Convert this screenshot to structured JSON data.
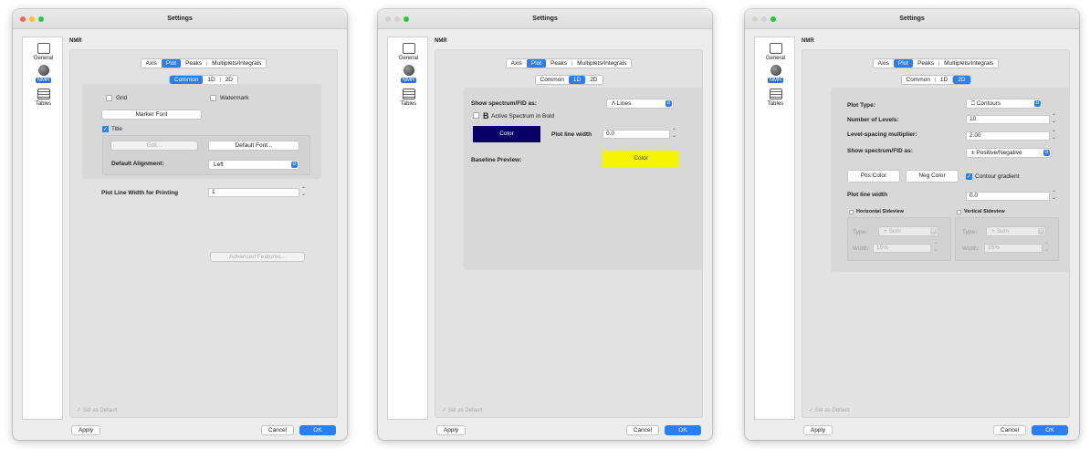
{
  "windows": [
    {
      "title": "Settings",
      "sidebar": [
        "General",
        "NMR",
        "Tables"
      ],
      "section_title": "NMR",
      "tabs": [
        "Axis",
        "Plot",
        "Peaks",
        "Multiplets/Integrals"
      ],
      "selected_tab": "Plot",
      "subtabs": [
        "Common",
        "1D",
        "2D"
      ],
      "selected_subtab": "Common",
      "common": {
        "grid_label": "Grid",
        "watermark_label": "Watermark",
        "marker_font_btn": "Marker Font",
        "title_label": "Title",
        "edit_btn": "Edit...",
        "default_font_btn": "Default Font...",
        "alignment_label": "Default Alignment:",
        "alignment_value": "Left",
        "print_width_label": "Plot Line Width for Printing",
        "print_width_value": "1",
        "advanced_btn": "Advanced Features..."
      },
      "set_default": "Set as Default",
      "apply": "Apply",
      "cancel": "Cancel",
      "ok": "OK"
    },
    {
      "title": "Settings",
      "sidebar": [
        "General",
        "NMR",
        "Tables"
      ],
      "section_title": "NMR",
      "tabs": [
        "Axis",
        "Plot",
        "Peaks",
        "Multiplets/Integrals"
      ],
      "selected_tab": "Plot",
      "subtabs": [
        "Common",
        "1D",
        "2D"
      ],
      "selected_subtab": "1D",
      "oned": {
        "show_as_label": "Show spectrum/FID as:",
        "show_as_value": "Lines",
        "active_bold_label": "Active Spectrum in Bold",
        "color_btn": "Color",
        "color_btn_hex": "#0b0067",
        "line_width_label": "Plot line width",
        "line_width_value": "0.0",
        "baseline_label": "Baseline Preview:",
        "baseline_btn": "Color",
        "baseline_hex": "#f5f500"
      },
      "set_default": "Set as Default",
      "apply": "Apply",
      "cancel": "Cancel",
      "ok": "OK"
    },
    {
      "title": "Settings",
      "sidebar": [
        "General",
        "NMR",
        "Tables"
      ],
      "section_title": "NMR",
      "tabs": [
        "Axis",
        "Plot",
        "Peaks",
        "Multiplets/Integrals"
      ],
      "selected_tab": "Plot",
      "subtabs": [
        "Common",
        "1D",
        "2D"
      ],
      "selected_subtab": "2D",
      "twod": {
        "plot_type_label": "Plot Type:",
        "plot_type_value": "Contours",
        "levels_label": "Number of Levels:",
        "levels_value": "10",
        "spacing_label": "Level-spacing multiplier:",
        "spacing_value": "2.00",
        "show_as_label": "Show spectrum/FID as:",
        "show_as_value": "Positive/Negative",
        "pos_color_btn": "Pos Color",
        "neg_color_btn": "Neg Color",
        "contour_gradient_label": "Contour gradient",
        "line_width_label": "Plot line width",
        "line_width_value": "0.0",
        "h_sideview_label": "Horizontal Sideview",
        "v_sideview_label": "Vertical Sideview",
        "type_label": "Type:",
        "type_value": "Sum",
        "width_label": "Width:",
        "width_value": "15%"
      },
      "set_default": "Set as Default",
      "apply": "Apply",
      "cancel": "Cancel",
      "ok": "OK"
    }
  ]
}
